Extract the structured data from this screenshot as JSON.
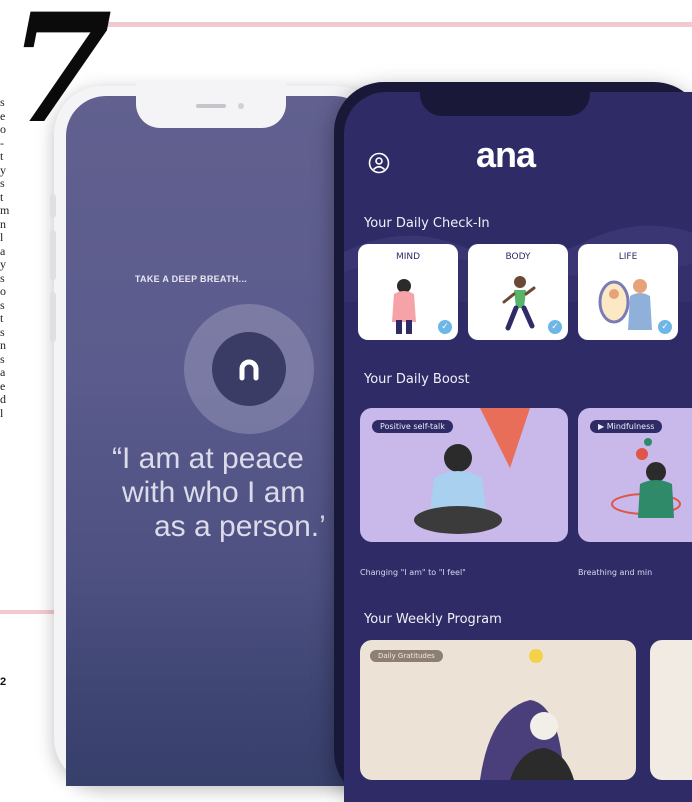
{
  "page": {
    "chapter_number": "7",
    "page_number": "2",
    "margin_text": "s e o - t y s t m n l a y s o s t s n s a e d l"
  },
  "back_phone": {
    "prompt": "TAKE A DEEP BREATH...",
    "app_icon": "ana-logo-icon",
    "quote_open": "“",
    "quote_line1": "I am at peace",
    "quote_line2": "with who I am",
    "quote_line3": "as a person.",
    "quote_close": "’"
  },
  "front_phone": {
    "logo": "ana",
    "profile_icon": "user-profile-icon",
    "daily_checkin": {
      "title": "Your Daily Check-In",
      "cards": [
        {
          "label": "MIND"
        },
        {
          "label": "BODY"
        },
        {
          "label": "LIFE"
        }
      ]
    },
    "daily_boost": {
      "title": "Your Daily Boost",
      "cards": [
        {
          "tag": "Positive self-talk",
          "caption": "Changing \"I am\" to \"I feel\""
        },
        {
          "tag": "▶ Mindfulness",
          "caption": "Breathing and min"
        }
      ]
    },
    "weekly_program": {
      "title": "Your Weekly Program",
      "cards": [
        {
          "tag": "Daily Gratitudes"
        }
      ]
    }
  },
  "colors": {
    "accent_pink": "#f2c9d0",
    "app_background": "#2f2b66",
    "check_blue": "#6db6e6"
  }
}
